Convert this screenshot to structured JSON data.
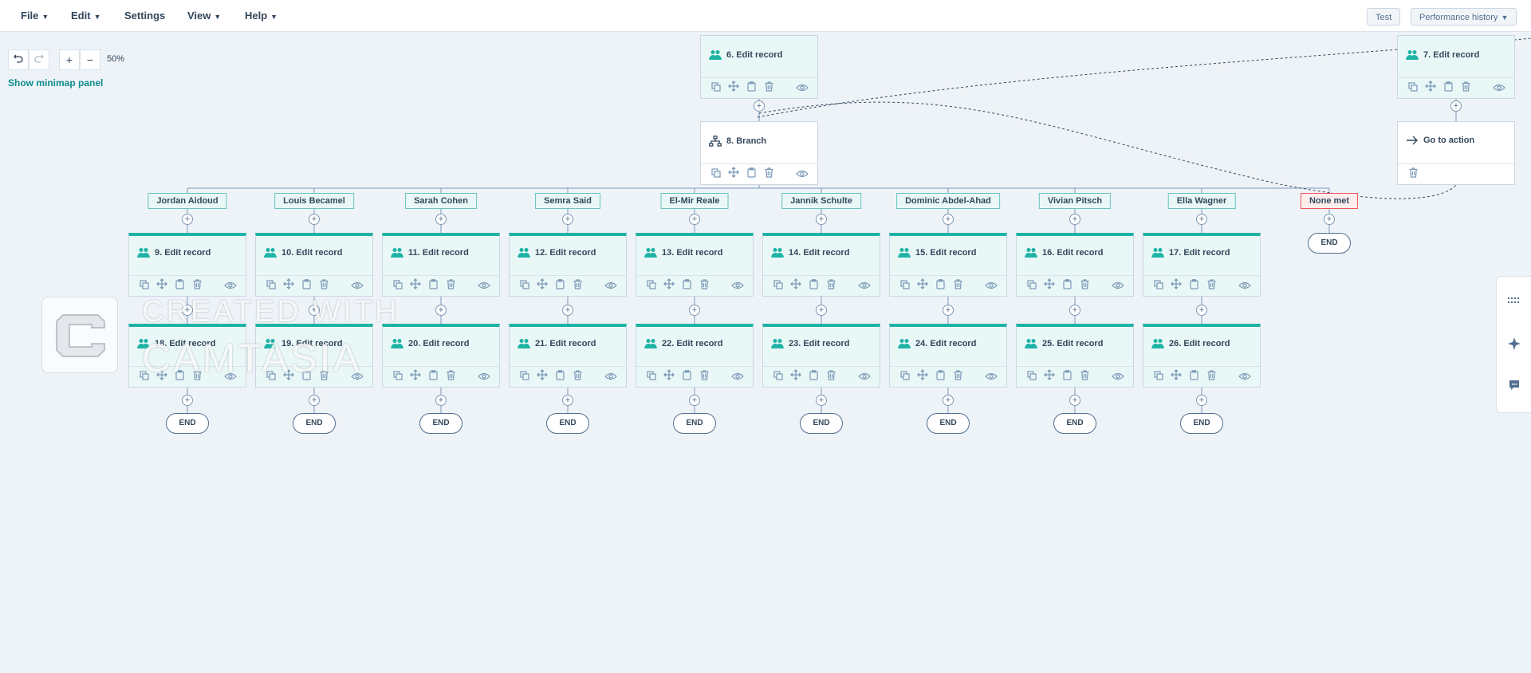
{
  "menu": {
    "file": "File",
    "edit": "Edit",
    "settings": "Settings",
    "view": "View",
    "help": "Help"
  },
  "toolbar": {
    "test": "Test",
    "performance_history": "Performance history"
  },
  "zoom": {
    "level": "50%"
  },
  "minimap_link": "Show minimap panel",
  "nodes": {
    "n6": "6. Edit record",
    "n7": "7. Edit record",
    "n8": "8. Branch",
    "goto": "Go to action"
  },
  "branches": [
    {
      "label": "Jordan Aidoud",
      "first": "9. Edit record",
      "second": "18. Edit record"
    },
    {
      "label": "Louis Becamel",
      "first": "10. Edit record",
      "second": "19. Edit record"
    },
    {
      "label": "Sarah Cohen",
      "first": "11. Edit record",
      "second": "20. Edit record"
    },
    {
      "label": "Semra Said",
      "first": "12. Edit record",
      "second": "21. Edit record"
    },
    {
      "label": "El-Mir Reale",
      "first": "13. Edit record",
      "second": "22. Edit record"
    },
    {
      "label": "Jannik Schulte",
      "first": "14. Edit record",
      "second": "23. Edit record"
    },
    {
      "label": "Dominic Abdel-Ahad",
      "first": "15. Edit record",
      "second": "24. Edit record"
    },
    {
      "label": "Vivian Pitsch",
      "first": "16. Edit record",
      "second": "25. Edit record"
    },
    {
      "label": "Ella Wagner",
      "first": "17. Edit record",
      "second": "26. Edit record"
    }
  ],
  "none_met": "None met",
  "end_label": "END",
  "watermark": {
    "line1": "CREATED WITH",
    "line2": "CAMTASIA"
  },
  "colors": {
    "accent": "#1fb3a6",
    "link": "#0f8c8c",
    "danger": "#f2545b"
  },
  "icons": [
    "users-icon",
    "branch-icon",
    "arrow-right-icon",
    "copy-icon",
    "move-icon",
    "clipboard-icon",
    "trash-icon",
    "eye-icon",
    "undo-icon",
    "redo-icon",
    "grid-icon",
    "sparkle-icon",
    "chat-icon"
  ]
}
